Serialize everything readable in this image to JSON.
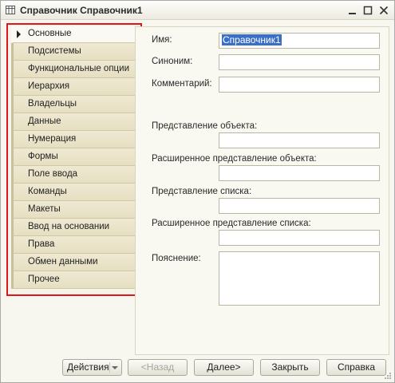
{
  "window": {
    "title": "Справочник Справочник1"
  },
  "sidebar": {
    "items": [
      {
        "label": "Основные",
        "active": true
      },
      {
        "label": "Подсистемы"
      },
      {
        "label": "Функциональные опции"
      },
      {
        "label": "Иерархия"
      },
      {
        "label": "Владельцы"
      },
      {
        "label": "Данные"
      },
      {
        "label": "Нумерация"
      },
      {
        "label": "Формы"
      },
      {
        "label": "Поле ввода"
      },
      {
        "label": "Команды"
      },
      {
        "label": "Макеты"
      },
      {
        "label": "Ввод на основании"
      },
      {
        "label": "Права"
      },
      {
        "label": "Обмен данными"
      },
      {
        "label": "Прочее"
      }
    ]
  },
  "form": {
    "name_label": "Имя:",
    "name_value": "Справочник1",
    "synonym_label": "Синоним:",
    "synonym_value": "",
    "comment_label": "Комментарий:",
    "comment_value": "",
    "object_repr_label": "Представление объекта:",
    "object_repr_value": "",
    "ext_object_repr_label": "Расширенное представление объекта:",
    "ext_object_repr_value": "",
    "list_repr_label": "Представление списка:",
    "list_repr_value": "",
    "ext_list_repr_label": "Расширенное представление списка:",
    "ext_list_repr_value": "",
    "explanation_label": "Пояснение:",
    "explanation_value": ""
  },
  "footer": {
    "actions": "Действия",
    "back": "<Назад",
    "next": "Далее>",
    "close": "Закрыть",
    "help": "Справка"
  },
  "icons": {
    "app": "table-icon",
    "minimize": "minimize-icon",
    "maximize": "maximize-icon",
    "close": "close-icon"
  }
}
